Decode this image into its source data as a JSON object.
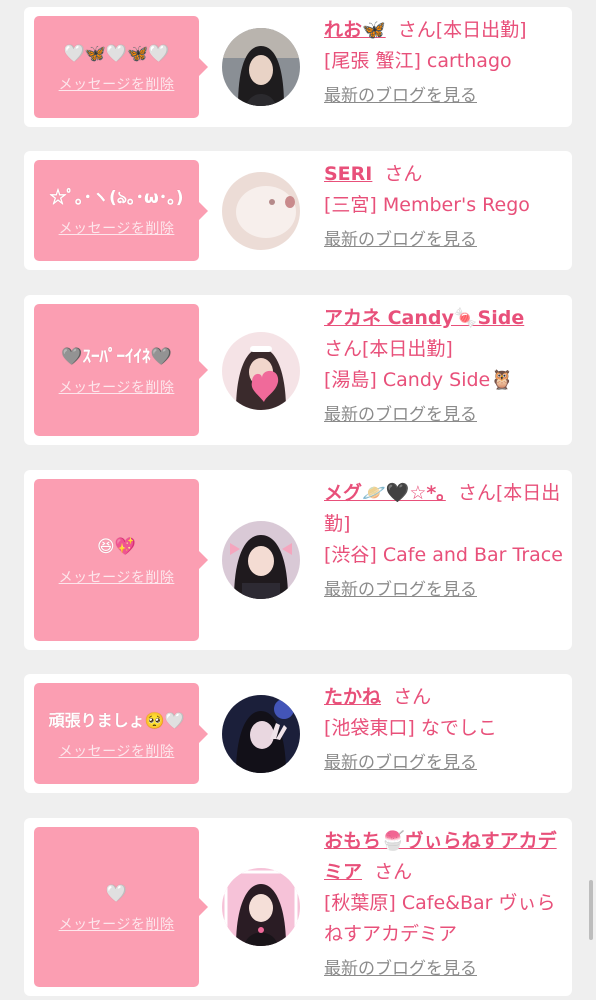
{
  "delete_label": "メッセージを削除",
  "blog_label": "最新のブログを見る",
  "san": "さん",
  "accent_color": "#e8507a",
  "bubble_color": "#fb9eb2",
  "cards": [
    {
      "message": "🤍🦋🤍🦋🤍",
      "name": "れお🦋",
      "status": "[本日出勤]",
      "shop": "[尾張 蟹江] carthago",
      "avatar": "portrait-dark-hair"
    },
    {
      "message": "☆ﾟ｡･ヽ(ঌ｡･ω･｡)",
      "name": "SERI",
      "status": "",
      "shop": "[三宮] Member's Rego",
      "avatar": "white-cat"
    },
    {
      "message": "🩶ｽｰﾊﾟｰｲｲﾈ🩶",
      "name": "アカネ Candy🍬Side",
      "status": "[本日出勤]",
      "shop": "[湯島] Candy Side🦉",
      "avatar": "maid-heart"
    },
    {
      "message": "😆💖",
      "name": "メグ🪐🖤☆*｡",
      "status": "[本日出勤]",
      "shop": "[渋谷] Cafe and Bar Trace",
      "avatar": "girl-pink-bows"
    },
    {
      "message": "頑張りましょ🥺🤍",
      "name": "たかね",
      "status": "",
      "shop": "[池袋東口] なでしこ",
      "avatar": "peace-sign"
    },
    {
      "message": "🤍",
      "name": "おもち🍧ヴぃらねすアカデミア",
      "status": "",
      "shop": "[秋葉原] Cafe&Bar ヴぃらねすアカデミア",
      "avatar": "idol-pink-frame"
    }
  ]
}
